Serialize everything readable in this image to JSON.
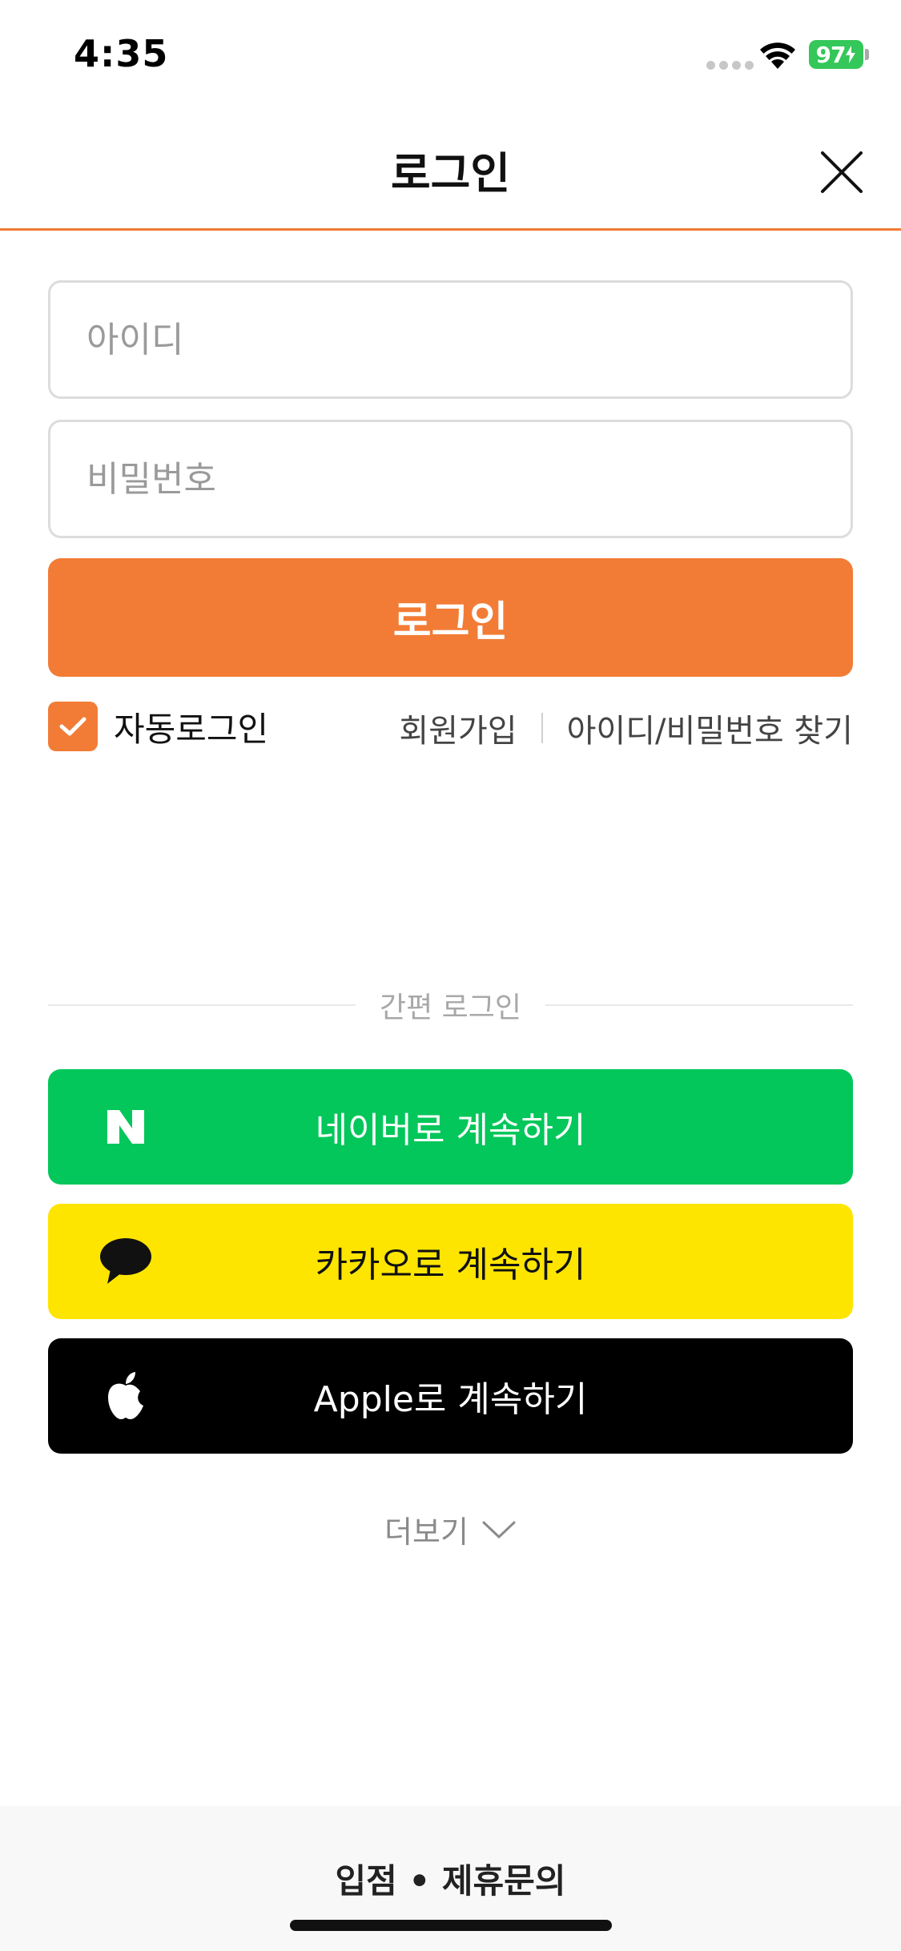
{
  "status_bar": {
    "time": "4:35",
    "battery": "97"
  },
  "header": {
    "title": "로그인"
  },
  "form": {
    "id_placeholder": "아이디",
    "id_value": "",
    "password_placeholder": "비밀번호",
    "password_value": "",
    "login_label": "로그인"
  },
  "options": {
    "auto_login_label": "자동로그인",
    "auto_login_checked": true,
    "signup_label": "회원가입",
    "find_label": "아이디/비밀번호 찾기"
  },
  "easy_login": {
    "divider_label": "간편 로그인",
    "buttons": [
      {
        "label": "네이버로 계속하기",
        "icon": "naver-logo-icon",
        "color": "#03c75a"
      },
      {
        "label": "카카오로 계속하기",
        "icon": "kakao-speech-bubble-icon",
        "color": "#fee500"
      },
      {
        "label": "Apple로 계속하기",
        "icon": "apple-logo-icon",
        "color": "#000000"
      }
    ],
    "more_label": "더보기"
  },
  "footer": {
    "partner_label": "입점 • 제휴문의"
  },
  "colors": {
    "accent": "#f27c36",
    "header_border": "#f07b35",
    "battery": "#34c759"
  }
}
